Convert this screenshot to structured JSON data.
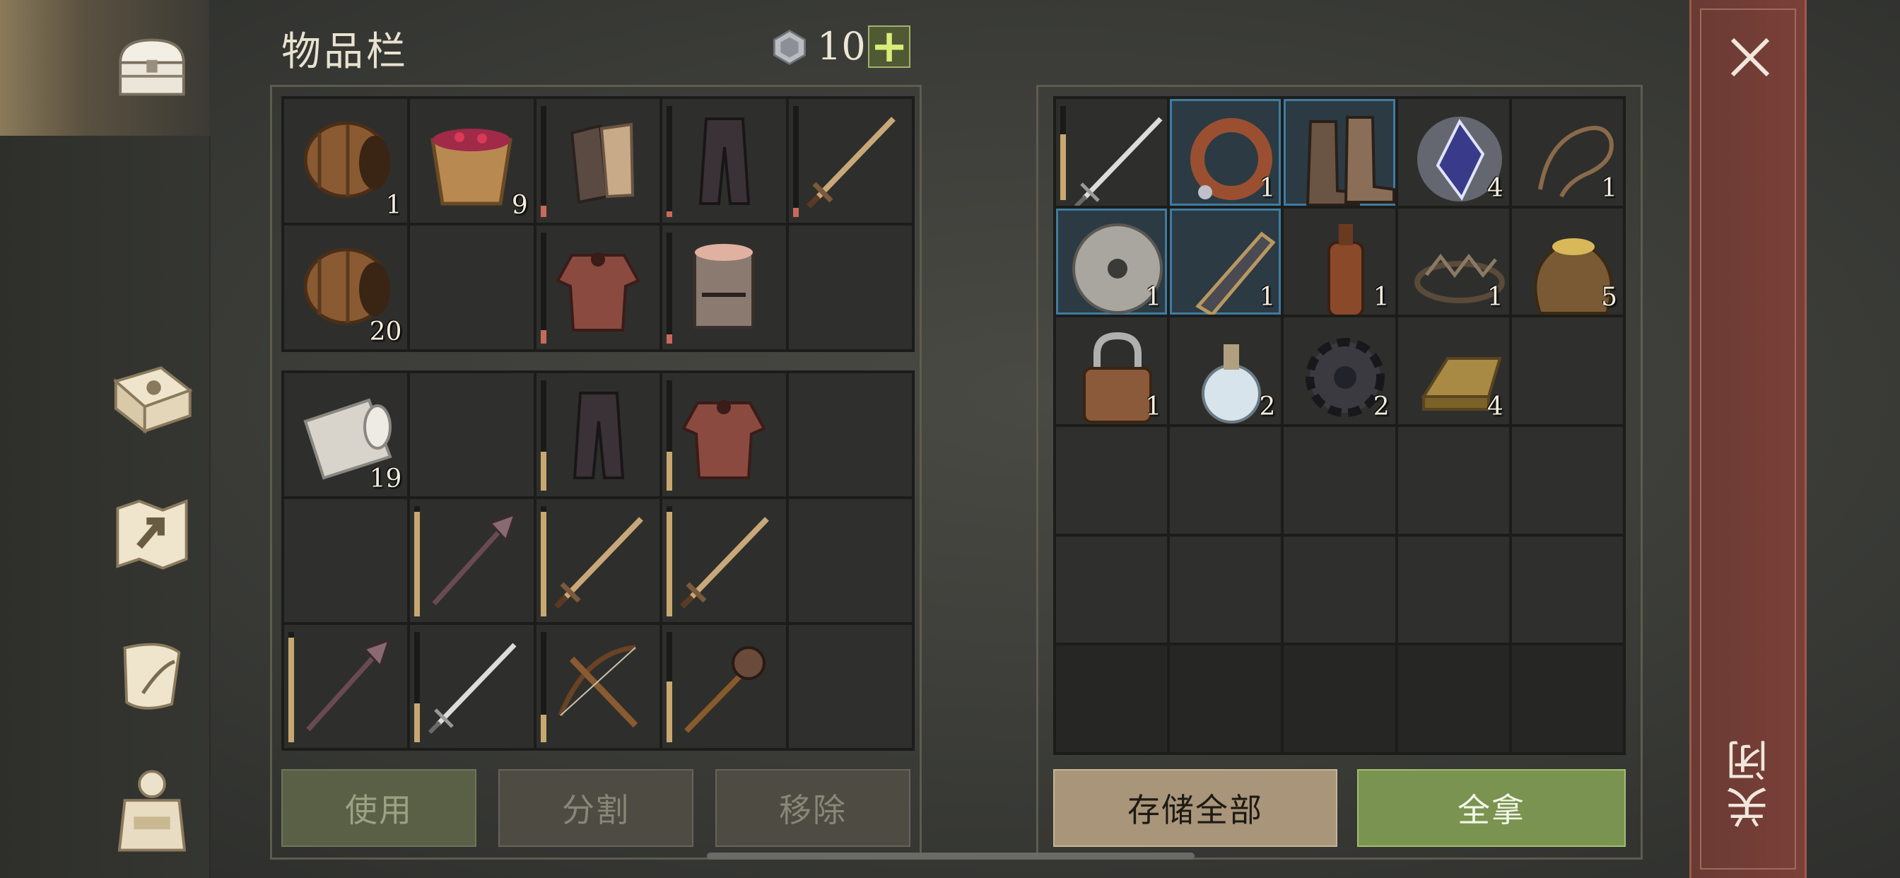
{
  "inventory": {
    "title": "物品栏",
    "currency": {
      "icon": "gem-icon",
      "amount": "10",
      "add_label": "+"
    },
    "upper_grid": [
      {
        "item": "barrel",
        "count": "1"
      },
      {
        "item": "berry-bucket",
        "count": "9"
      },
      {
        "item": "gloves",
        "count": "",
        "durability": 0.1,
        "low": true
      },
      {
        "item": "pants",
        "count": "",
        "durability": 0.05,
        "low": true
      },
      {
        "item": "sword",
        "count": "",
        "durability": 0.08,
        "low": true
      },
      {
        "item": "barrel",
        "count": "20"
      },
      {
        "item": "",
        "count": ""
      },
      {
        "item": "chainmail",
        "count": "",
        "durability": 0.12,
        "low": true
      },
      {
        "item": "helmet",
        "count": "",
        "durability": 0.08,
        "low": true
      },
      {
        "item": "",
        "count": ""
      }
    ],
    "lower_grid": [
      {
        "item": "cloth-roll",
        "count": "19"
      },
      {
        "item": "",
        "count": ""
      },
      {
        "item": "pants",
        "count": "",
        "durability": 0.35
      },
      {
        "item": "chainmail",
        "count": "",
        "durability": 0.35
      },
      {
        "item": "",
        "count": ""
      },
      {
        "item": "",
        "count": ""
      },
      {
        "item": "mace",
        "count": "",
        "durability": 0.95
      },
      {
        "item": "sword",
        "count": "",
        "durability": 0.95
      },
      {
        "item": "sword",
        "count": "",
        "durability": 0.95
      },
      {
        "item": "",
        "count": ""
      },
      {
        "item": "mace",
        "count": "",
        "durability": 0.95
      },
      {
        "item": "steel-sword",
        "count": "",
        "durability": 0.35
      },
      {
        "item": "crossbow",
        "count": "",
        "durability": 0.25
      },
      {
        "item": "morningstar",
        "count": "",
        "durability": 0.55
      },
      {
        "item": "",
        "count": ""
      }
    ],
    "buttons": {
      "use": "使用",
      "split": "分割",
      "remove": "移除"
    }
  },
  "container": {
    "grid": [
      {
        "item": "steel-sword",
        "count": "",
        "durability": 0.7
      },
      {
        "item": "collar",
        "count": "1",
        "hl": true
      },
      {
        "item": "boots",
        "count": "",
        "hl": true
      },
      {
        "item": "crystal",
        "count": "4"
      },
      {
        "item": "rope",
        "count": "1"
      },
      {
        "item": "stone-disc",
        "count": "1",
        "hl": true
      },
      {
        "item": "weapon-part",
        "count": "1",
        "hl": true
      },
      {
        "item": "bottle",
        "count": "1"
      },
      {
        "item": "trap",
        "count": "1"
      },
      {
        "item": "grain-sack",
        "count": "5"
      },
      {
        "item": "padlock",
        "count": "1"
      },
      {
        "item": "potion",
        "count": "2"
      },
      {
        "item": "gear",
        "count": "2"
      },
      {
        "item": "ingot",
        "count": "4"
      },
      {
        "item": "",
        "count": ""
      },
      {
        "item": "",
        "count": ""
      },
      {
        "item": "",
        "count": ""
      },
      {
        "item": "",
        "count": ""
      },
      {
        "item": "",
        "count": ""
      },
      {
        "item": "",
        "count": ""
      },
      {
        "item": "",
        "count": ""
      },
      {
        "item": "",
        "count": ""
      },
      {
        "item": "",
        "count": ""
      },
      {
        "item": "",
        "count": ""
      },
      {
        "item": "",
        "count": ""
      },
      {
        "item": "",
        "count": "",
        "dim": true
      },
      {
        "item": "",
        "count": "",
        "dim": true
      },
      {
        "item": "",
        "count": "",
        "dim": true
      },
      {
        "item": "",
        "count": "",
        "dim": true
      },
      {
        "item": "",
        "count": "",
        "dim": true
      }
    ],
    "buttons": {
      "store_all": "存储全部",
      "take_all": "全拿"
    }
  },
  "nav": [
    "chest-icon",
    "sun-book-icon",
    "map-icon",
    "scroll-icon",
    "backpack-icon"
  ],
  "close": {
    "label": "关闭",
    "icon": "close-icon"
  }
}
